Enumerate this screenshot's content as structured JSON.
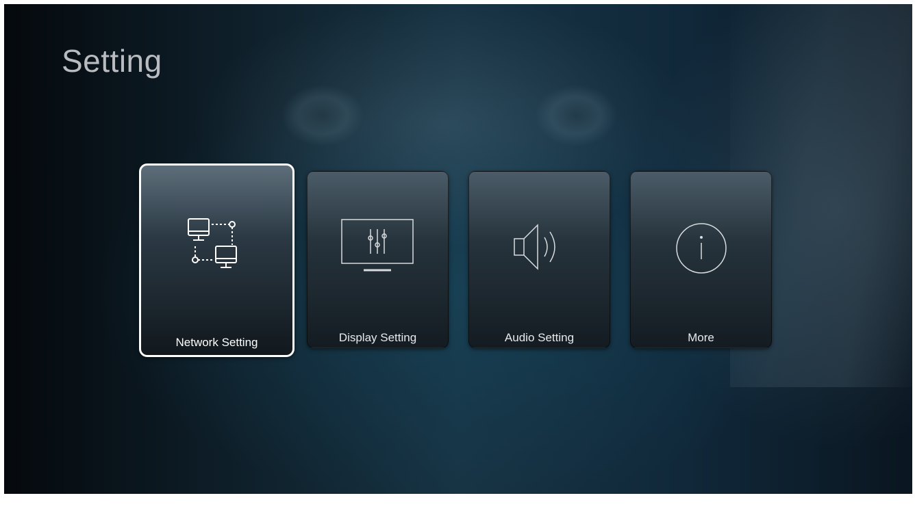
{
  "page": {
    "title": "Setting"
  },
  "menu": {
    "items": [
      {
        "label": "Network Setting",
        "icon": "network-icon",
        "selected": true
      },
      {
        "label": "Display Setting",
        "icon": "display-settings-icon",
        "selected": false
      },
      {
        "label": "Audio Setting",
        "icon": "speaker-icon",
        "selected": false
      },
      {
        "label": "More",
        "icon": "info-icon",
        "selected": false
      }
    ]
  },
  "colors": {
    "selected_border": "#ffffff",
    "title_text": "#b8bcc0",
    "label_text": "#e8eaec"
  }
}
